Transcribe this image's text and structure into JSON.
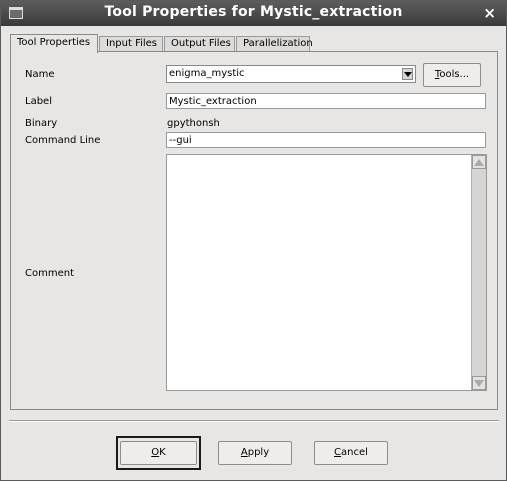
{
  "window": {
    "title": "Tool Properties for Mystic_extraction",
    "close_glyph": "×"
  },
  "tabs": [
    {
      "label": "Tool Properties",
      "active": true
    },
    {
      "label": "Input Files",
      "active": false
    },
    {
      "label": "Output Files",
      "active": false
    },
    {
      "label": "Parallelization",
      "active": false
    }
  ],
  "form": {
    "name_label": "Name",
    "name_value": "enigma_mystic",
    "tools_button": "Tools...",
    "label_label": "Label",
    "label_value": "Mystic_extraction",
    "binary_label": "Binary",
    "binary_value": "gpythonsh",
    "command_line_label": "Command Line",
    "command_line_value": "--gui",
    "comment_label": "Comment",
    "comment_value": ""
  },
  "buttons": {
    "ok": "OK",
    "apply": "Apply",
    "cancel": "Cancel"
  }
}
